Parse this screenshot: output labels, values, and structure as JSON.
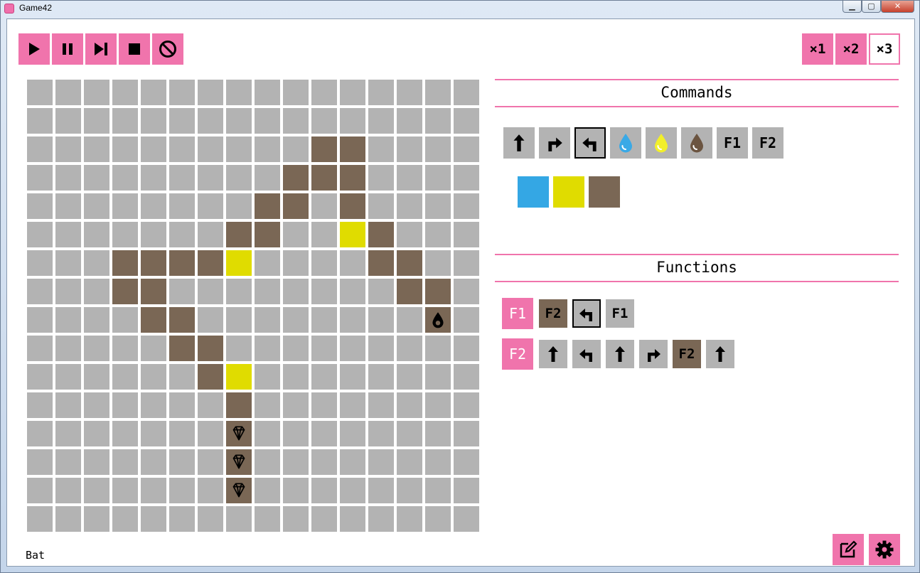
{
  "window": {
    "title": "Game42",
    "close_glyph": "✕",
    "min_glyph": "▁",
    "max_glyph": "▢"
  },
  "playback": [
    {
      "name": "play-button",
      "icon": "play-icon"
    },
    {
      "name": "pause-button",
      "icon": "pause-icon"
    },
    {
      "name": "step-button",
      "icon": "step-forward-icon"
    },
    {
      "name": "stop-button",
      "icon": "stop-icon"
    },
    {
      "name": "clear-button",
      "icon": "no-entry-icon"
    }
  ],
  "speeds": {
    "x1": "×1",
    "x2": "×2",
    "x3": "×3",
    "selected": "x3"
  },
  "board": {
    "size": 16,
    "colors": {
      "floor": "#b3b3b3",
      "brown": "#7a6755",
      "yellow": "#e0dc00"
    },
    "brown_cells": [
      [
        2,
        10
      ],
      [
        2,
        11
      ],
      [
        3,
        9
      ],
      [
        3,
        10
      ],
      [
        3,
        11
      ],
      [
        4,
        8
      ],
      [
        4,
        9
      ],
      [
        4,
        11
      ],
      [
        5,
        7
      ],
      [
        5,
        8
      ],
      [
        5,
        12
      ],
      [
        6,
        3
      ],
      [
        6,
        4
      ],
      [
        6,
        5
      ],
      [
        6,
        6
      ],
      [
        6,
        12
      ],
      [
        6,
        13
      ],
      [
        7,
        3
      ],
      [
        7,
        4
      ],
      [
        7,
        13
      ],
      [
        7,
        14
      ],
      [
        8,
        4
      ],
      [
        8,
        5
      ],
      [
        8,
        14
      ],
      [
        9,
        5
      ],
      [
        9,
        6
      ],
      [
        10,
        6
      ],
      [
        11,
        7
      ],
      [
        12,
        7
      ],
      [
        13,
        7
      ],
      [
        14,
        7
      ]
    ],
    "yellow_cells": [
      [
        5,
        11
      ],
      [
        6,
        7
      ],
      [
        10,
        7
      ]
    ],
    "gem_cells": [
      [
        12,
        7
      ],
      [
        13,
        7
      ],
      [
        14,
        7
      ]
    ],
    "robot_cell": [
      8,
      14
    ]
  },
  "commands": {
    "heading": "Commands",
    "items": [
      {
        "type": "icon",
        "icon": "forward-arrow-icon",
        "name": "cmd-forward"
      },
      {
        "type": "icon",
        "icon": "turn-right-icon",
        "name": "cmd-turn-right"
      },
      {
        "type": "icon",
        "icon": "turn-left-icon",
        "name": "cmd-turn-left",
        "selected": true
      },
      {
        "type": "drop",
        "icon": "blue-drop-icon",
        "name": "cmd-paint-blue",
        "color": "#3aa9e6"
      },
      {
        "type": "drop",
        "icon": "yellow-drop-icon",
        "name": "cmd-paint-yellow",
        "color": "#f2ef2a"
      },
      {
        "type": "drop",
        "icon": "brown-drop-icon",
        "name": "cmd-paint-brown",
        "color": "#6b5440"
      },
      {
        "type": "text",
        "label": "F1",
        "name": "cmd-f1"
      },
      {
        "type": "text",
        "label": "F2",
        "name": "cmd-f2"
      }
    ],
    "conditions": [
      {
        "name": "condition-blue",
        "color": "#34a7e4"
      },
      {
        "name": "condition-yellow",
        "color": "#e0dc00"
      },
      {
        "name": "condition-brown",
        "color": "#7a6755"
      }
    ]
  },
  "functions": {
    "heading": "Functions",
    "rows": [
      {
        "label": "F1",
        "slots": [
          {
            "type": "text",
            "label": "F2",
            "bg": "brown"
          },
          {
            "type": "icon",
            "icon": "turn-left-icon",
            "selected": true
          },
          {
            "type": "text",
            "label": "F1"
          }
        ]
      },
      {
        "label": "F2",
        "slots": [
          {
            "type": "icon",
            "icon": "forward-arrow-icon"
          },
          {
            "type": "icon",
            "icon": "turn-left-icon"
          },
          {
            "type": "icon",
            "icon": "forward-arrow-icon"
          },
          {
            "type": "icon",
            "icon": "turn-right-icon"
          },
          {
            "type": "text",
            "label": "F2",
            "bg": "brown"
          },
          {
            "type": "icon",
            "icon": "forward-arrow-icon"
          }
        ]
      }
    ]
  },
  "status": {
    "text": "Bat"
  },
  "tools": [
    {
      "name": "edit-button",
      "icon": "edit-icon"
    },
    {
      "name": "settings-button",
      "icon": "gear-icon"
    }
  ]
}
